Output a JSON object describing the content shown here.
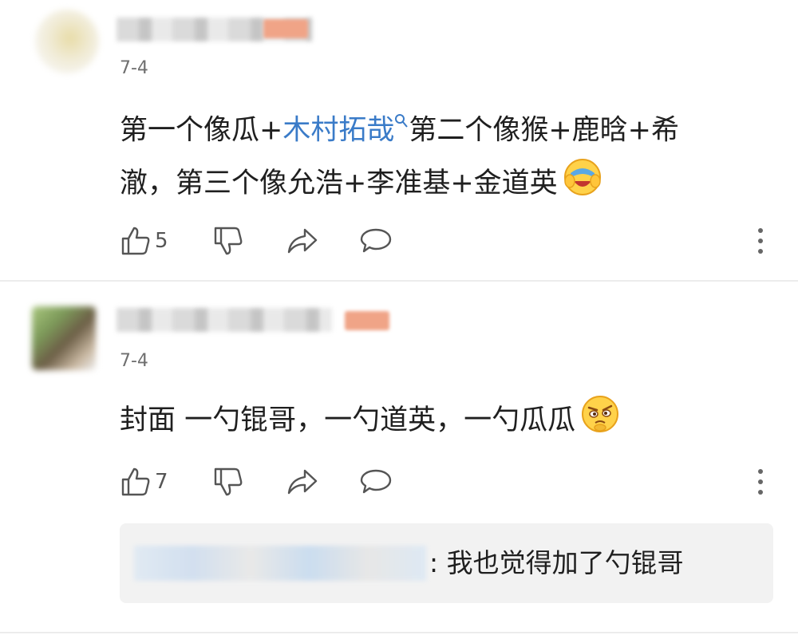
{
  "comments": [
    {
      "time": "7-4",
      "text_before": "第一个像瓜+",
      "link_text": "木村拓哉",
      "text_after": "第二个像猴+鹿晗+希澈，第三个像允浩+李准基+金道英",
      "emoji": "laughing-covering-face-emoji",
      "likes": "5"
    },
    {
      "time": "7-4",
      "text": "封面 一勺锟哥，一勺道英，一勺瓜瓜",
      "emoji": "skeptical-face-emoji",
      "likes": "7",
      "reply": {
        "text": ": 我也觉得加了勺锟哥"
      }
    }
  ],
  "icons": {
    "like": "thumbs-up-icon",
    "dislike": "thumbs-down-icon",
    "share": "share-arrow-icon",
    "reply": "speech-bubble-icon",
    "more": "more-vertical-icon",
    "link_search": "search-icon"
  },
  "colors": {
    "link": "#3a7bc8",
    "icon": "#555555",
    "reply_bg": "#f2f2f2"
  }
}
